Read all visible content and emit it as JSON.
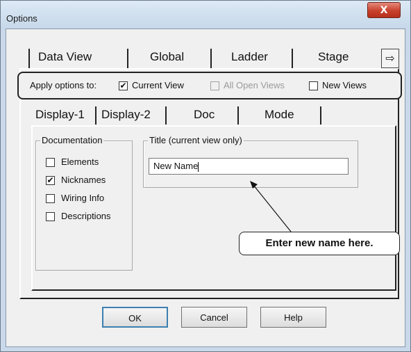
{
  "window": {
    "title": "Options",
    "close_glyph": "X"
  },
  "outer_tabs": [
    {
      "label": "Data View"
    },
    {
      "label": "Global"
    },
    {
      "label": "Ladder"
    },
    {
      "label": "Stage"
    }
  ],
  "tab_scroll_icon": "arrow-right-icon",
  "apply": {
    "label": "Apply options to:",
    "current_view": {
      "label": "Current View",
      "checked": true
    },
    "all_open_views": {
      "label": "All Open Views",
      "checked": false,
      "disabled": true
    },
    "new_views": {
      "label": "New Views",
      "checked": false
    }
  },
  "inner_tabs": [
    {
      "label": "Display-1"
    },
    {
      "label": "Display-2"
    },
    {
      "label": "Doc",
      "selected": true
    },
    {
      "label": "Mode"
    }
  ],
  "documentation": {
    "group_label": "Documentation",
    "items": [
      {
        "label": "Elements",
        "checked": false
      },
      {
        "label": "Nicknames",
        "checked": true
      },
      {
        "label": "Wiring Info",
        "checked": false
      },
      {
        "label": "Descriptions",
        "checked": false
      }
    ]
  },
  "title_group": {
    "group_label": "Title (current view only)",
    "value": "New Name"
  },
  "callout": "Enter new name here.",
  "buttons": {
    "ok": "OK",
    "cancel": "Cancel",
    "help": "Help"
  }
}
